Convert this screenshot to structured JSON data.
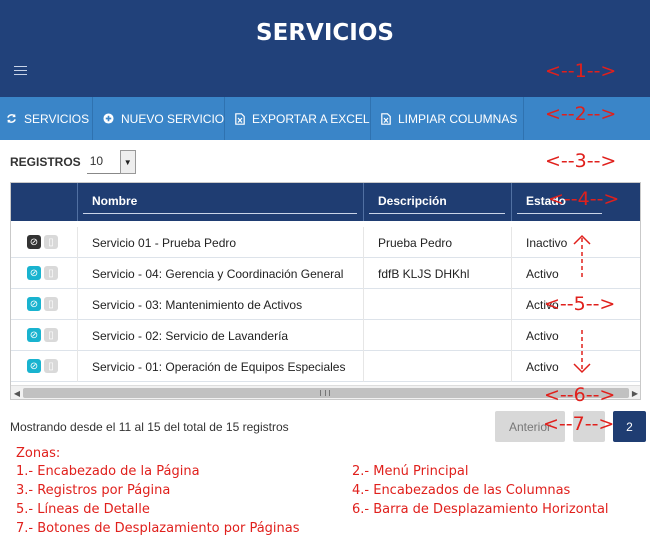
{
  "header": {
    "title": "SERVICIOS"
  },
  "menu": {
    "items": [
      {
        "icon": "refresh-icon",
        "label": "SERVICIOS"
      },
      {
        "icon": "plus-circle-icon",
        "label": "NUEVO SERVICIO"
      },
      {
        "icon": "excel-file-icon",
        "label": "EXPORTAR A EXCEL"
      },
      {
        "icon": "file-clear-icon",
        "label": "LIMPIAR COLUMNAS"
      }
    ]
  },
  "zones_markers": [
    "<--1-->",
    "<--2-->",
    "<--3-->",
    "<--4-->",
    "<--5-->",
    "<--6-->",
    "<--7-->"
  ],
  "page_size": {
    "label": "REGISTROS",
    "value": "10"
  },
  "table": {
    "columns": [
      "Nombre",
      "Descripción",
      "Estado"
    ],
    "rows": [
      {
        "nombre": "Servicio 01 - Prueba Pedro",
        "descripcion": "Prueba Pedro",
        "estado": "Inactivo",
        "toggle": "inactive"
      },
      {
        "nombre": "Servicio - 04: Gerencia y Coordinación General",
        "descripcion": "fdfB KLJS DHKhl",
        "estado": "Activo",
        "toggle": "active"
      },
      {
        "nombre": "Servicio - 03: Mantenimiento de Activos",
        "descripcion": "",
        "estado": "Activo",
        "toggle": "active"
      },
      {
        "nombre": "Servicio - 02: Servicio de Lavandería",
        "descripcion": "",
        "estado": "Activo",
        "toggle": "active"
      },
      {
        "nombre": "Servicio - 01: Operación de Equipos Especiales",
        "descripcion": "",
        "estado": "Activo",
        "toggle": "active"
      }
    ]
  },
  "footer": {
    "summary": "Mostrando desde el 11 al 15 del total de 15 registros"
  },
  "pager": {
    "prev": "Anterior",
    "next": "",
    "current": "2"
  },
  "legend": {
    "title": "Zonas:",
    "items": [
      "1.- Encabezado de la Página",
      "2.- Menú Principal",
      "3.- Registros por Página",
      "4.- Encabezados de las Columnas",
      "5.- Líneas de Detalle",
      "6.- Barra de Desplazamiento Horizontal",
      "7.- Botones de Desplazamiento por Páginas"
    ]
  },
  "colors": {
    "header": "#21417a",
    "menu": "#3a85c8",
    "table_head": "#1f3d72",
    "toggle_active": "#19b3cf",
    "annotation": "#e0201c"
  }
}
